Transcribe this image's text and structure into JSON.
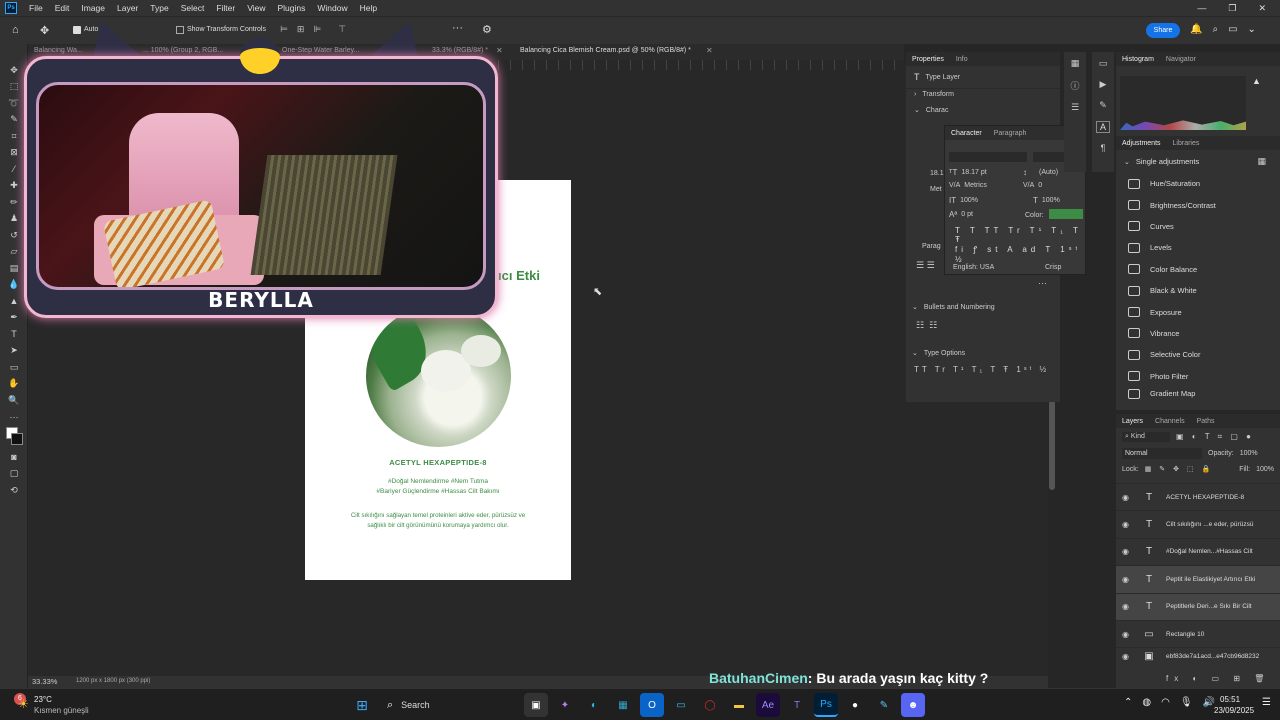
{
  "menu": [
    "File",
    "Edit",
    "Image",
    "Layer",
    "Type",
    "Select",
    "Filter",
    "View",
    "Plugins",
    "Window",
    "Help"
  ],
  "options": {
    "auto_label": "Auto",
    "transform_label": "Show Transform Controls",
    "share": "Share"
  },
  "tabs": [
    {
      "label": "Balancing Wa..."
    },
    {
      "label": "... 100% (Group 2, RGB..."
    },
    {
      "label": "One-Step Water Barley..."
    },
    {
      "label": "33.3% (RGB/8#) *"
    },
    {
      "label": "Balancing Cica Blemish Cream.psd @ 50% (RGB/8#) *"
    }
  ],
  "webcam": {
    "name": "BERYLLA"
  },
  "document": {
    "headline": "rıcı Etki",
    "ingredient": "ACETYL HEXAPEPTIDE-8",
    "tags1": "#Doğal Nemlendirme #Nem Tutma",
    "tags2": "#Bariyer Güçlendirme #Hassas Cilt Bakımı",
    "body1": "Cilt sıkılığını sağlayan temel proteinleri aktive eder, pürüzsüz ve",
    "body2": "sağlıklı bir cilt görünümünü korumaya yardımcı olur."
  },
  "status": {
    "zoom": "33.33%",
    "docsize": "1200 px x 1800 px (300 ppi)"
  },
  "properties": {
    "tabs": [
      "Properties",
      "Info"
    ],
    "type_layer": "Type Layer",
    "transform": "Transform",
    "character_short": "Charac",
    "paragraph_short": "Parag",
    "size_short": "18.1",
    "metrics_short": "Met",
    "bullets": "Bullets and Numbering",
    "type_options": "Type Options"
  },
  "character": {
    "tabs": [
      "Character",
      "Paragraph"
    ],
    "size": "18.17 pt",
    "leading": "(Auto)",
    "kerning": "Metrics",
    "tracking": "0",
    "vscale": "100%",
    "hscale": "100%",
    "baseline": "0 pt",
    "color_label": "Color:",
    "language": "English: USA",
    "aa": "Crisp"
  },
  "histogram": {
    "tabs": [
      "Histogram",
      "Navigator"
    ]
  },
  "adjustments": {
    "tabs": [
      "Adjustments",
      "Libraries"
    ],
    "section": "Single adjustments",
    "items": [
      "Hue/Saturation",
      "Brightness/Contrast",
      "Curves",
      "Levels",
      "Color Balance",
      "Black & White",
      "Exposure",
      "Vibrance",
      "Selective Color",
      "Photo Filter",
      "Gradient Map"
    ]
  },
  "layers": {
    "tabs": [
      "Layers",
      "Channels",
      "Paths"
    ],
    "kind": "Kind",
    "blend": "Normal",
    "opacity_label": "Opacity:",
    "opacity": "100%",
    "lock_label": "Lock:",
    "fill_label": "Fill:",
    "fill": "100%",
    "items": [
      {
        "name": "ACETYL HEXAPEPTIDE-8",
        "icon": "T"
      },
      {
        "name": "Cilt sıkılığını ...e eder, pürüzsü",
        "icon": "T"
      },
      {
        "name": "#Doğal Nemlen...#Hassas Cilt",
        "icon": "T"
      },
      {
        "name": "Peptit ile Elastikiyet Artırıcı Etki",
        "icon": "T"
      },
      {
        "name": "Peptitlerle Deri...e Sıkı Bir Cilt",
        "icon": "T"
      },
      {
        "name": "Rectangle 10",
        "icon": "▭"
      },
      {
        "name": "ebf83de7a1acd...e47cb96d8232",
        "icon": "▣"
      }
    ]
  },
  "chat": {
    "user": "BatuhanCimen",
    "message": ": Bu arada yaşın kaç kitty ?"
  },
  "taskbar": {
    "temp": "23°C",
    "weather": "Kısmen güneşli",
    "badge": "6",
    "search": "Search",
    "time": "05:51",
    "date": "23/09/2025"
  },
  "colors": {
    "accent": "#3d8c45",
    "share": "#1473e6",
    "chat_user": "#7fe3d8"
  }
}
